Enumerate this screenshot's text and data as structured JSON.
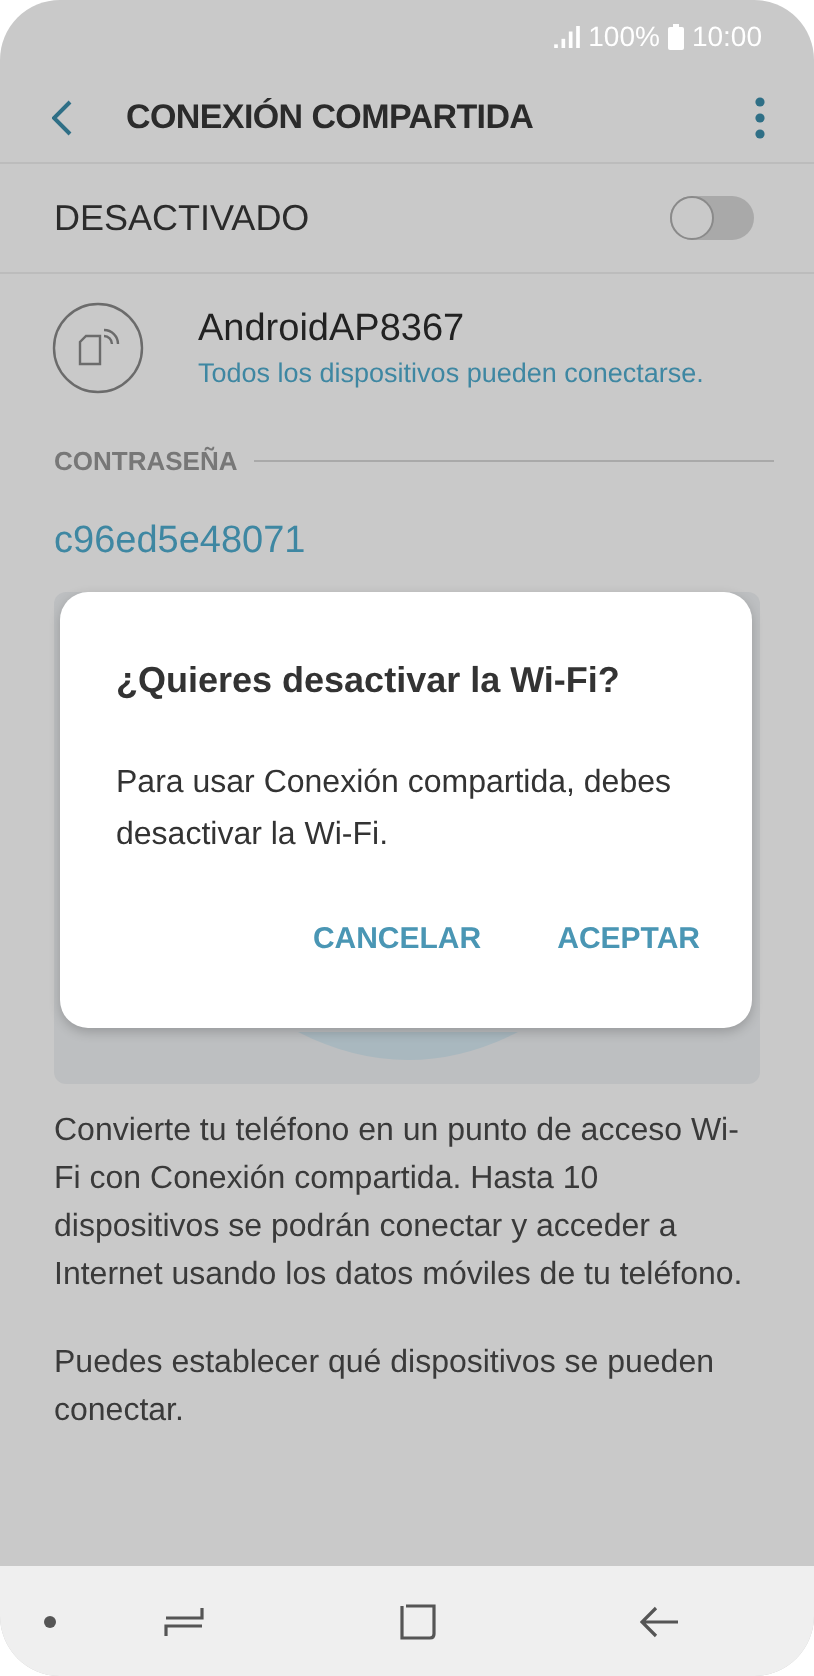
{
  "status_bar": {
    "battery": "100%",
    "time": "10:00"
  },
  "header": {
    "title": "CONEXIÓN COMPARTIDA"
  },
  "master_switch": {
    "label": "DESACTIVADO",
    "on": false
  },
  "network": {
    "name": "AndroidAP8367",
    "subtitle": "Todos los dispositivos pueden conectarse."
  },
  "password_section": {
    "heading": "CONTRASEÑA",
    "value": "c96ed5e48071"
  },
  "description": [
    "Convierte tu teléfono en un punto de acceso Wi-Fi con Conexión compartida. Hasta 10 dispositivos se podrán conectar y acceder a Internet usando los datos móviles de tu teléfono.",
    "Puedes establecer qué dispositivos se pueden conectar."
  ],
  "dialog": {
    "title": "¿Quieres desactivar la Wi-Fi?",
    "message": "Para usar Conexión compartida, debes desactivar la Wi-Fi.",
    "buttons": [
      "CANCELAR",
      "ACEPTAR"
    ]
  }
}
